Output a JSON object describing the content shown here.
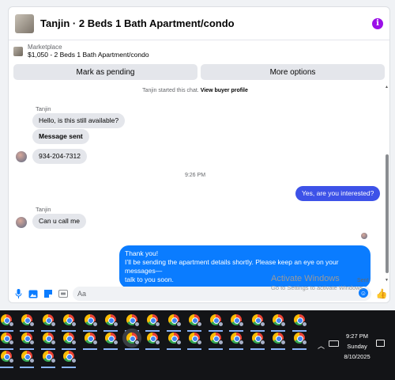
{
  "header": {
    "title": "Tanjin · 2 Beds 1 Bath Apartment/condo",
    "info_icon": "i"
  },
  "listing": {
    "source": "Marketplace",
    "item": "$1,050 - 2 Beds 1 Bath Apartment/condo"
  },
  "actions": {
    "pending": "Mark as pending",
    "more": "More options"
  },
  "chat": {
    "started_prefix": "Tanjin started this chat. ",
    "started_link": "View buyer profile",
    "sender_name_1": "Tanjin",
    "msg1": "Hello, is this still available?",
    "msg2": "Message sent",
    "msg3": "934-204-7312",
    "time_divider": "9:26 PM",
    "reply1": "Yes, are you interested?",
    "sender_name_2": "Tanjin",
    "msg4": "Can u call me",
    "reply2_line1": "Thank you!",
    "reply2_line2": "I’ll be sending the apartment details shortly. Please keep an eye on your messages—",
    "reply2_line3": "talk to you soon.",
    "status": "Sent"
  },
  "composer": {
    "placeholder": "Aa",
    "like_icon": "👍"
  },
  "watermark": {
    "line1": "Activate Windows",
    "line2": "Go to Settings to activate Windows."
  },
  "tray": {
    "time": "9:27 PM",
    "day": "Sunday",
    "date": "8/10/2025"
  }
}
